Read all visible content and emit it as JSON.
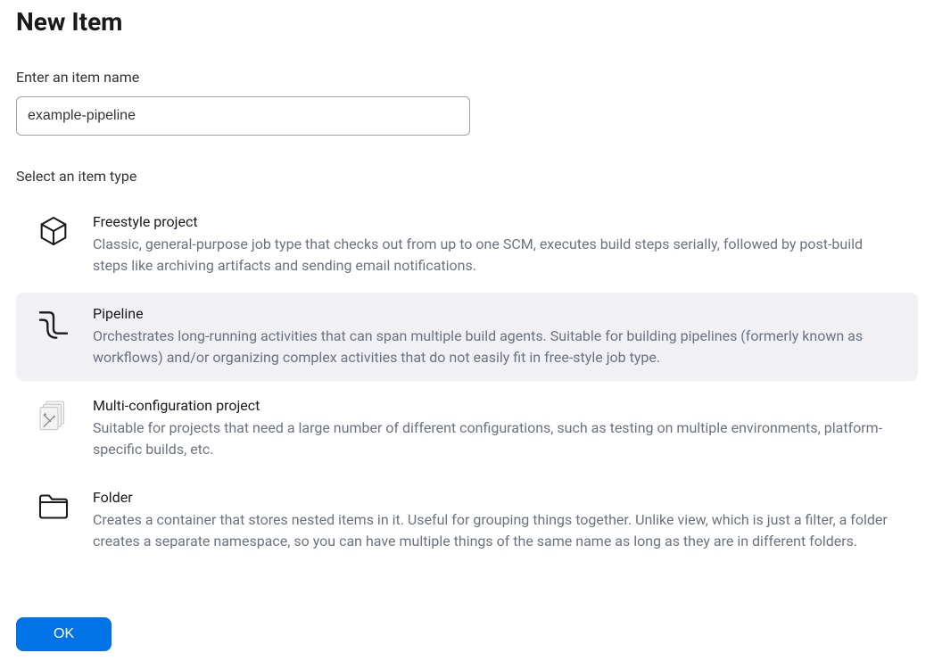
{
  "page": {
    "title": "New Item",
    "name_label": "Enter an item name",
    "name_value": "example-pipeline",
    "select_label": "Select an item type",
    "ok_label": "OK"
  },
  "item_types": {
    "freestyle": {
      "title": "Freestyle project",
      "desc": "Classic, general-purpose job type that checks out from up to one SCM, executes build steps serially, followed by post-build steps like archiving artifacts and sending email notifications."
    },
    "pipeline": {
      "title": "Pipeline",
      "desc": "Orchestrates long-running activities that can span multiple build agents. Suitable for building pipelines (formerly known as workflows) and/or organizing complex activities that do not easily fit in free-style job type."
    },
    "multiconfig": {
      "title": "Multi-configuration project",
      "desc": "Suitable for projects that need a large number of different configurations, such as testing on multiple environments, platform-specific builds, etc."
    },
    "folder": {
      "title": "Folder",
      "desc": "Creates a container that stores nested items in it. Useful for grouping things together. Unlike view, which is just a filter, a folder creates a separate namespace, so you can have multiple things of the same name as long as they are in different folders."
    }
  }
}
